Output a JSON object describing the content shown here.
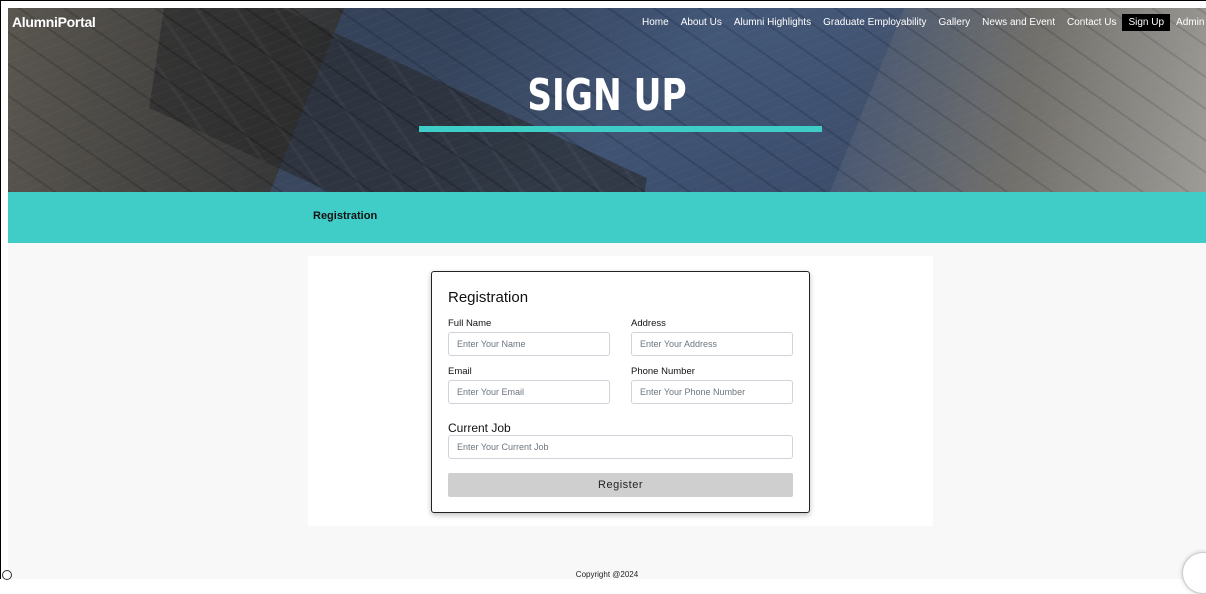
{
  "header": {
    "logo": "AlumniPortal",
    "nav": [
      {
        "label": "Home"
      },
      {
        "label": "About Us"
      },
      {
        "label": "Alumni Highlights"
      },
      {
        "label": "Graduate Employability"
      },
      {
        "label": "Gallery"
      },
      {
        "label": "News and Event"
      },
      {
        "label": "Contact Us"
      },
      {
        "label": "Sign Up"
      },
      {
        "label": "Admin"
      }
    ],
    "active_nav": "Sign Up"
  },
  "hero": {
    "title": "SIGN UP",
    "underline_color": "#3ecdc7"
  },
  "band": {
    "title": "Registration",
    "color": "#40cdc8"
  },
  "form": {
    "title": "Registration",
    "full_name": {
      "label": "Full Name",
      "placeholder": "Enter Your Name"
    },
    "address": {
      "label": "Address",
      "placeholder": "Enter Your Address"
    },
    "email": {
      "label": "Email",
      "placeholder": "Enter Your Email"
    },
    "phone": {
      "label": "Phone Number",
      "placeholder": "Enter Your Phone Number"
    },
    "current_job": {
      "label": "Current Job",
      "placeholder": "Enter Your Current Job"
    },
    "submit_label": "Register"
  },
  "footer": {
    "copyright": "Copyright @2024"
  }
}
